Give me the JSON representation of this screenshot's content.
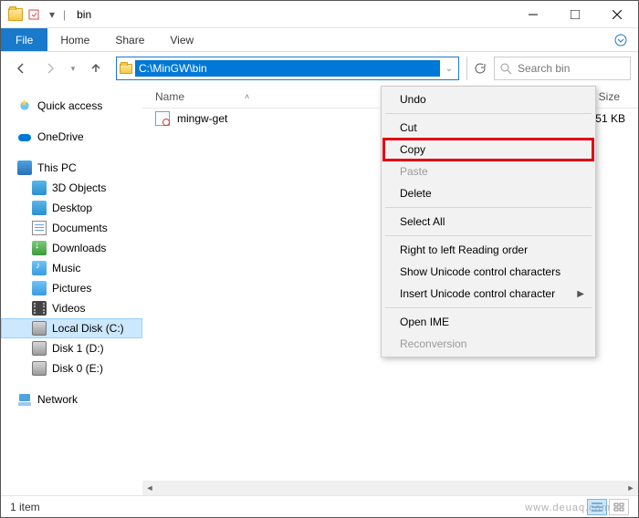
{
  "window": {
    "title": "bin",
    "separator": "|"
  },
  "ribbon": {
    "file": "File",
    "home": "Home",
    "share": "Share",
    "view": "View"
  },
  "address": {
    "path": "C:\\MinGW\\bin"
  },
  "search": {
    "placeholder": "Search bin"
  },
  "sidebar": {
    "quick_access": "Quick access",
    "onedrive": "OneDrive",
    "this_pc": "This PC",
    "items": [
      {
        "label": "3D Objects"
      },
      {
        "label": "Desktop"
      },
      {
        "label": "Documents"
      },
      {
        "label": "Downloads"
      },
      {
        "label": "Music"
      },
      {
        "label": "Pictures"
      },
      {
        "label": "Videos"
      },
      {
        "label": "Local Disk (C:)"
      },
      {
        "label": "Disk 1 (D:)"
      },
      {
        "label": "Disk 0 (E:)"
      }
    ],
    "network": "Network"
  },
  "columns": {
    "name": "Name",
    "size": "Size"
  },
  "files": [
    {
      "name": "mingw-get",
      "size": "51 KB"
    }
  ],
  "context_menu": {
    "items": [
      {
        "label": "Undo",
        "enabled": true
      },
      {
        "sep": true
      },
      {
        "label": "Cut",
        "enabled": true
      },
      {
        "label": "Copy",
        "enabled": true,
        "highlight": true
      },
      {
        "label": "Paste",
        "enabled": false
      },
      {
        "label": "Delete",
        "enabled": true
      },
      {
        "sep": true
      },
      {
        "label": "Select All",
        "enabled": true
      },
      {
        "sep": true
      },
      {
        "label": "Right to left Reading order",
        "enabled": true
      },
      {
        "label": "Show Unicode control characters",
        "enabled": true
      },
      {
        "label": "Insert Unicode control character",
        "enabled": true,
        "submenu": true
      },
      {
        "sep": true
      },
      {
        "label": "Open IME",
        "enabled": true
      },
      {
        "label": "Reconversion",
        "enabled": false
      }
    ]
  },
  "status": {
    "item_count": "1 item"
  },
  "watermark": "www.deuaq.com"
}
